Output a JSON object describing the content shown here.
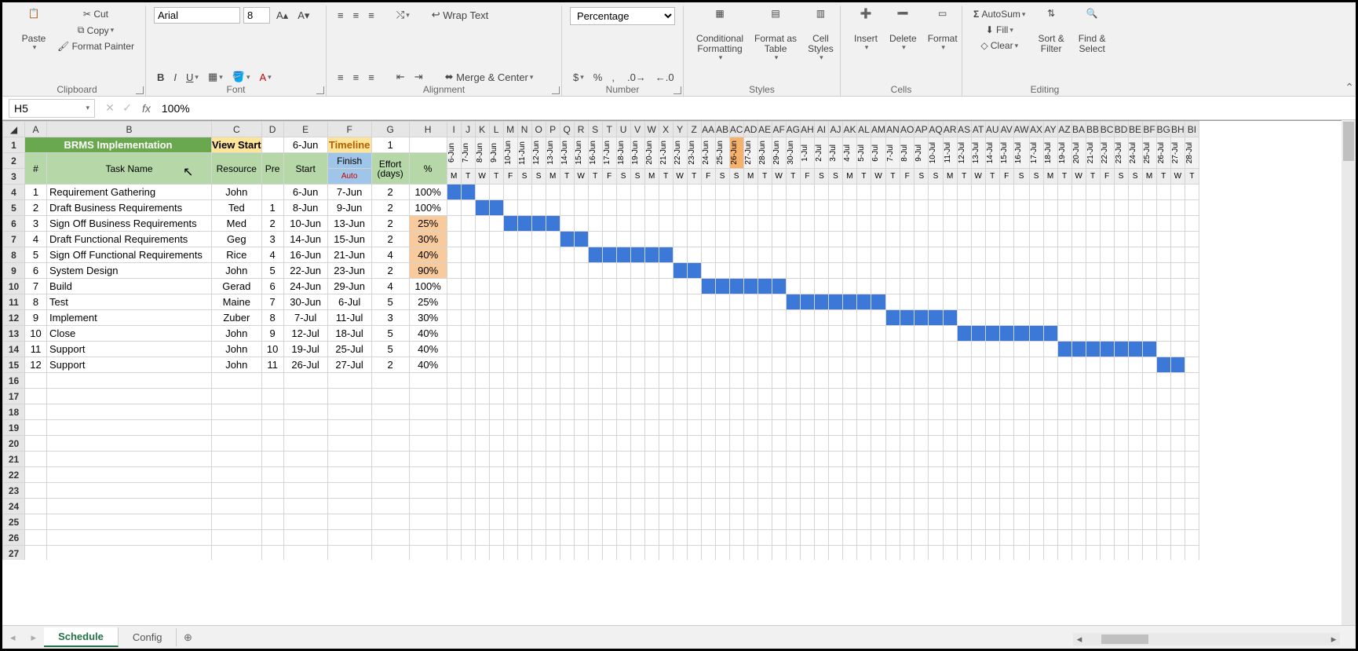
{
  "ribbon": {
    "clipboard": {
      "paste": "Paste",
      "cut": "Cut",
      "copy": "Copy",
      "painter": "Format Painter",
      "label": "Clipboard"
    },
    "font": {
      "name": "Arial",
      "size": "8",
      "label": "Font"
    },
    "alignment": {
      "wrap": "Wrap Text",
      "merge": "Merge & Center",
      "label": "Alignment"
    },
    "number": {
      "style": "Percentage",
      "label": "Number"
    },
    "styles": {
      "cond": "Conditional\nFormatting",
      "fmt": "Format as\nTable",
      "cell": "Cell\nStyles",
      "label": "Styles"
    },
    "cells": {
      "ins": "Insert",
      "del": "Delete",
      "fmt": "Format",
      "label": "Cells"
    },
    "editing": {
      "sum": "AutoSum",
      "fill": "Fill",
      "clear": "Clear",
      "sort": "Sort &\nFilter",
      "find": "Find &\nSelect",
      "label": "Editing"
    }
  },
  "namebox": "H5",
  "formula": "100%",
  "sheet": {
    "title": "BRMS Implementation",
    "view_start_lbl": "View Start",
    "view_start": "6-Jun",
    "timeline_lbl": "Timeline",
    "timeline_val": "1",
    "hdr_num": "#",
    "hdr_task": "Task Name",
    "hdr_res": "Resource",
    "hdr_pre": "Pre",
    "hdr_start": "Start",
    "hdr_finish": "Finish",
    "hdr_auto": "Auto",
    "hdr_eff": "Effort\n(days)",
    "hdr_pct": "%"
  },
  "chart_data": {
    "type": "gantt",
    "title": "BRMS Implementation",
    "start_date": "6-Jun",
    "today": "26-Jun",
    "days": [
      {
        "d": "6-Jun",
        "w": "M"
      },
      {
        "d": "7-Jun",
        "w": "T"
      },
      {
        "d": "8-Jun",
        "w": "W"
      },
      {
        "d": "9-Jun",
        "w": "T"
      },
      {
        "d": "10-Jun",
        "w": "F"
      },
      {
        "d": "11-Jun",
        "w": "S"
      },
      {
        "d": "12-Jun",
        "w": "S"
      },
      {
        "d": "13-Jun",
        "w": "M"
      },
      {
        "d": "14-Jun",
        "w": "T"
      },
      {
        "d": "15-Jun",
        "w": "W"
      },
      {
        "d": "16-Jun",
        "w": "T"
      },
      {
        "d": "17-Jun",
        "w": "F"
      },
      {
        "d": "18-Jun",
        "w": "S"
      },
      {
        "d": "19-Jun",
        "w": "S"
      },
      {
        "d": "20-Jun",
        "w": "M"
      },
      {
        "d": "21-Jun",
        "w": "T"
      },
      {
        "d": "22-Jun",
        "w": "W"
      },
      {
        "d": "23-Jun",
        "w": "T"
      },
      {
        "d": "24-Jun",
        "w": "F"
      },
      {
        "d": "25-Jun",
        "w": "S"
      },
      {
        "d": "26-Jun",
        "w": "S"
      },
      {
        "d": "27-Jun",
        "w": "M"
      },
      {
        "d": "28-Jun",
        "w": "T"
      },
      {
        "d": "29-Jun",
        "w": "W"
      },
      {
        "d": "30-Jun",
        "w": "T"
      },
      {
        "d": "1-Jul",
        "w": "F"
      },
      {
        "d": "2-Jul",
        "w": "S"
      },
      {
        "d": "3-Jul",
        "w": "S"
      },
      {
        "d": "4-Jul",
        "w": "M"
      },
      {
        "d": "5-Jul",
        "w": "T"
      },
      {
        "d": "6-Jul",
        "w": "W"
      },
      {
        "d": "7-Jul",
        "w": "T"
      },
      {
        "d": "8-Jul",
        "w": "F"
      },
      {
        "d": "9-Jul",
        "w": "S"
      },
      {
        "d": "10-Jul",
        "w": "S"
      },
      {
        "d": "11-Jul",
        "w": "M"
      },
      {
        "d": "12-Jul",
        "w": "T"
      },
      {
        "d": "13-Jul",
        "w": "W"
      },
      {
        "d": "14-Jul",
        "w": "T"
      },
      {
        "d": "15-Jul",
        "w": "F"
      },
      {
        "d": "16-Jul",
        "w": "S"
      },
      {
        "d": "17-Jul",
        "w": "S"
      },
      {
        "d": "18-Jul",
        "w": "M"
      },
      {
        "d": "19-Jul",
        "w": "T"
      },
      {
        "d": "20-Jul",
        "w": "W"
      },
      {
        "d": "21-Jul",
        "w": "T"
      },
      {
        "d": "22-Jul",
        "w": "F"
      },
      {
        "d": "23-Jul",
        "w": "S"
      },
      {
        "d": "24-Jul",
        "w": "S"
      },
      {
        "d": "25-Jul",
        "w": "M"
      },
      {
        "d": "26-Jul",
        "w": "T"
      },
      {
        "d": "27-Jul",
        "w": "W"
      },
      {
        "d": "28-Jul",
        "w": "T"
      }
    ],
    "tasks": [
      {
        "n": 1,
        "name": "Requirement Gathering",
        "res": "John",
        "pre": "",
        "start": "6-Jun",
        "finish": "7-Jun",
        "eff": 2,
        "pct": "100%",
        "s": 0,
        "e": 2,
        "hl": false
      },
      {
        "n": 2,
        "name": "Draft Business Requirements",
        "res": "Ted",
        "pre": "1",
        "start": "8-Jun",
        "finish": "9-Jun",
        "eff": 2,
        "pct": "100%",
        "s": 2,
        "e": 4,
        "hl": false
      },
      {
        "n": 3,
        "name": "Sign Off Business Requirements",
        "res": "Med",
        "pre": "2",
        "start": "10-Jun",
        "finish": "13-Jun",
        "eff": 2,
        "pct": "25%",
        "s": 4,
        "e": 8,
        "hl": true
      },
      {
        "n": 4,
        "name": "Draft Functional Requirements",
        "res": "Geg",
        "pre": "3",
        "start": "14-Jun",
        "finish": "15-Jun",
        "eff": 2,
        "pct": "30%",
        "s": 8,
        "e": 10,
        "hl": true
      },
      {
        "n": 5,
        "name": "Sign Off Functional Requirements",
        "res": "Rice",
        "pre": "4",
        "start": "16-Jun",
        "finish": "21-Jun",
        "eff": 4,
        "pct": "40%",
        "s": 10,
        "e": 16,
        "hl": true
      },
      {
        "n": 6,
        "name": "System Design",
        "res": "John",
        "pre": "5",
        "start": "22-Jun",
        "finish": "23-Jun",
        "eff": 2,
        "pct": "90%",
        "s": 16,
        "e": 18,
        "hl": true
      },
      {
        "n": 7,
        "name": "Build",
        "res": "Gerad",
        "pre": "6",
        "start": "24-Jun",
        "finish": "29-Jun",
        "eff": 4,
        "pct": "100%",
        "s": 18,
        "e": 24,
        "hl": false
      },
      {
        "n": 8,
        "name": "Test",
        "res": "Maine",
        "pre": "7",
        "start": "30-Jun",
        "finish": "6-Jul",
        "eff": 5,
        "pct": "25%",
        "s": 24,
        "e": 31,
        "hl": false
      },
      {
        "n": 9,
        "name": "Implement",
        "res": "Zuber",
        "pre": "8",
        "start": "7-Jul",
        "finish": "11-Jul",
        "eff": 3,
        "pct": "30%",
        "s": 31,
        "e": 36,
        "hl": false
      },
      {
        "n": 10,
        "name": "Close",
        "res": "John",
        "pre": "9",
        "start": "12-Jul",
        "finish": "18-Jul",
        "eff": 5,
        "pct": "40%",
        "s": 36,
        "e": 43,
        "hl": false
      },
      {
        "n": 11,
        "name": "Support",
        "res": "John",
        "pre": "10",
        "start": "19-Jul",
        "finish": "25-Jul",
        "eff": 5,
        "pct": "40%",
        "s": 43,
        "e": 50,
        "hl": false
      },
      {
        "n": 12,
        "name": "Support",
        "res": "John",
        "pre": "11",
        "start": "26-Jul",
        "finish": "27-Jul",
        "eff": 2,
        "pct": "40%",
        "s": 50,
        "e": 52,
        "hl": false
      }
    ]
  },
  "col_letters": [
    "A",
    "B",
    "C",
    "D",
    "E",
    "F",
    "G",
    "H",
    "I",
    "J",
    "K",
    "L",
    "M",
    "N",
    "O",
    "P",
    "Q",
    "R",
    "S",
    "T",
    "U",
    "V",
    "W",
    "X",
    "Y",
    "Z",
    "AA",
    "AB",
    "AC",
    "AD",
    "AE",
    "AF",
    "AG",
    "AH",
    "AI",
    "AJ",
    "AK",
    "AL",
    "AM",
    "AN",
    "AO",
    "AP",
    "AQ",
    "AR",
    "AS",
    "AT",
    "AU",
    "AV",
    "AW",
    "AX",
    "AY",
    "AZ",
    "BA",
    "BB",
    "BC",
    "BD",
    "BE",
    "BF",
    "BG",
    "BH",
    "BI"
  ],
  "tabs": {
    "active": "Schedule",
    "other": "Config"
  }
}
